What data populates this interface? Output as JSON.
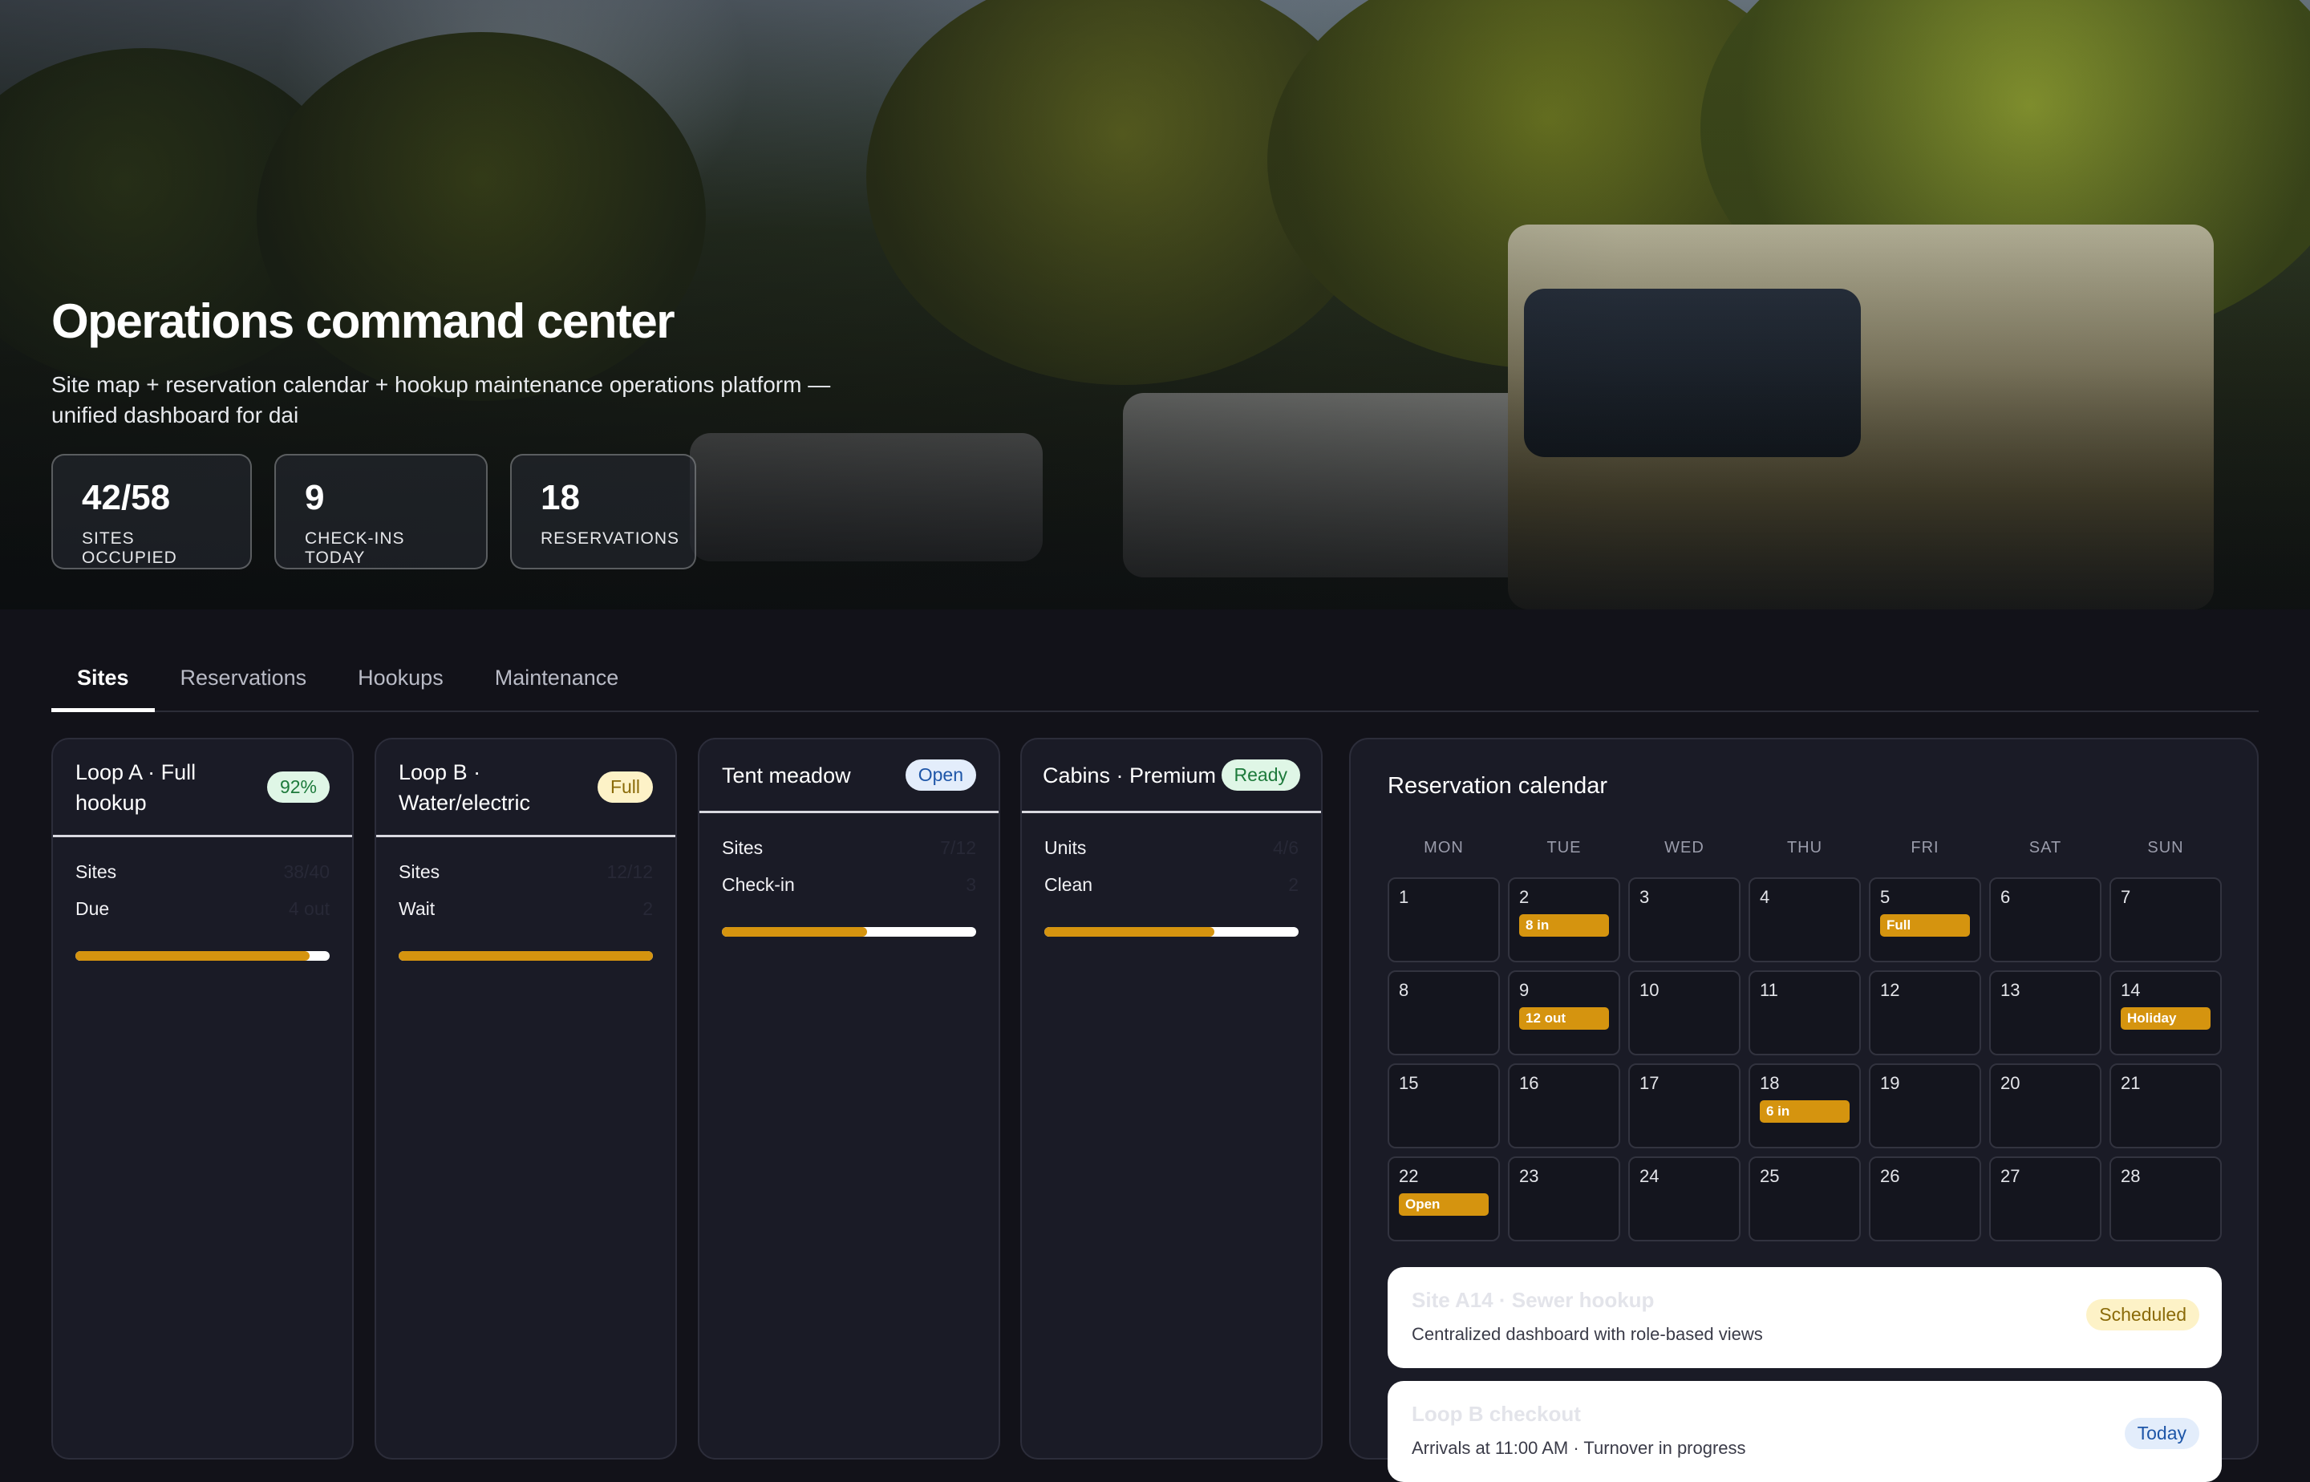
{
  "hero": {
    "title": "Operations command center",
    "subtitle": "Site map + reservation calendar + hookup maintenance operations platform — unified dashboard for dai",
    "stats": [
      {
        "value": "42/58",
        "label": "SITES OCCUPIED"
      },
      {
        "value": "9",
        "label": "CHECK-INS TODAY"
      },
      {
        "value": "18",
        "label": "RESERVATIONS"
      }
    ]
  },
  "tabs": [
    {
      "label": "Sites",
      "active": true
    },
    {
      "label": "Reservations",
      "active": false
    },
    {
      "label": "Hookups",
      "active": false
    },
    {
      "label": "Maintenance",
      "active": false
    }
  ],
  "site_cards": [
    {
      "title": "Loop A · Full hookup",
      "badge": "92%",
      "badge_tone": "green",
      "rows": [
        {
          "label": "Sites",
          "value": "38/40"
        },
        {
          "label": "Due",
          "value": "4 out"
        }
      ],
      "progress": 0.92
    },
    {
      "title": "Loop B · Water/electric",
      "badge": "Full",
      "badge_tone": "yellow",
      "rows": [
        {
          "label": "Sites",
          "value": "12/12"
        },
        {
          "label": "Wait",
          "value": "2"
        }
      ],
      "progress": 1.0
    },
    {
      "title": "Tent meadow",
      "badge": "Open",
      "badge_tone": "blue",
      "rows": [
        {
          "label": "Sites",
          "value": "7/12"
        },
        {
          "label": "Check-in",
          "value": "3"
        }
      ],
      "progress": 0.57
    },
    {
      "title": "Cabins · Premium",
      "badge": "Ready",
      "badge_tone": "green",
      "rows": [
        {
          "label": "Units",
          "value": "4/6"
        },
        {
          "label": "Clean",
          "value": "2"
        }
      ],
      "progress": 0.67
    }
  ],
  "calendar": {
    "title": "Reservation calendar",
    "weekdays": [
      "MON",
      "TUE",
      "WED",
      "THU",
      "FRI",
      "SAT",
      "SUN"
    ],
    "days": [
      {
        "n": "1"
      },
      {
        "n": "2",
        "event": "8 in"
      },
      {
        "n": "3"
      },
      {
        "n": "4"
      },
      {
        "n": "5",
        "event": "Full"
      },
      {
        "n": "6"
      },
      {
        "n": "7"
      },
      {
        "n": "8"
      },
      {
        "n": "9",
        "event": "12 out"
      },
      {
        "n": "10"
      },
      {
        "n": "11"
      },
      {
        "n": "12"
      },
      {
        "n": "13"
      },
      {
        "n": "14",
        "event": "Holiday"
      },
      {
        "n": "15"
      },
      {
        "n": "16"
      },
      {
        "n": "17"
      },
      {
        "n": "18",
        "event": "6 in"
      },
      {
        "n": "19"
      },
      {
        "n": "20"
      },
      {
        "n": "21"
      },
      {
        "n": "22",
        "event": "Open"
      },
      {
        "n": "23"
      },
      {
        "n": "24"
      },
      {
        "n": "25"
      },
      {
        "n": "26"
      },
      {
        "n": "27"
      },
      {
        "n": "28"
      }
    ]
  },
  "tasks": [
    {
      "title": "Site A14 · Sewer hookup",
      "desc": "Centralized dashboard with role-based views",
      "badge": "Scheduled",
      "badge_tone": "yellow"
    },
    {
      "title": "Loop B checkout",
      "desc": "Arrivals at 11:00 AM · Turnover in progress",
      "badge": "Today",
      "badge_tone": "blue"
    }
  ],
  "colors": {
    "accent": "#d5940f",
    "background": "#121219",
    "card": "#1a1b26"
  }
}
